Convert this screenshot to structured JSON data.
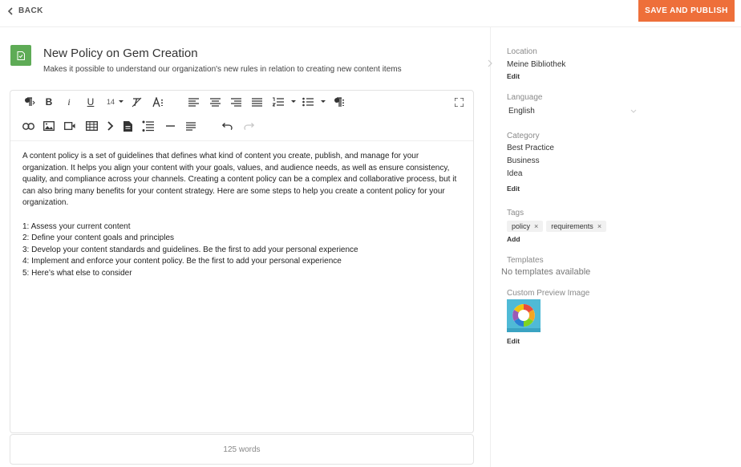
{
  "header": {
    "back_label": "BACK",
    "save_label": "SAVE AND PUBLISH",
    "accent": "#ee6f3a"
  },
  "document": {
    "title": "New Policy on Gem Creation",
    "subtitle": "Makes it possible to understand our organization's new rules in relation to creating new content items",
    "icon": "document-icon",
    "icon_color": "#5eab56"
  },
  "toolbar": {
    "font_size": "14",
    "buttons_row1": [
      "paragraph-format-icon",
      "bold-icon",
      "italic-icon",
      "underline-icon",
      "font-size-select",
      "clear-format-icon",
      "text-size-icon",
      "align-left-icon",
      "align-center-icon",
      "align-right-icon",
      "align-justify-icon",
      "ordered-list-icon",
      "unordered-list-icon",
      "paragraph-style-icon",
      "fullscreen-icon"
    ],
    "buttons_row2": [
      "link-icon",
      "image-icon",
      "video-icon",
      "table-icon",
      "code-icon",
      "file-icon",
      "checklist-icon",
      "horizontal-rule-icon",
      "text-align-icon",
      "undo-icon",
      "redo-icon"
    ]
  },
  "content": {
    "paragraph": "A content policy is a set of guidelines that defines what kind of content you create, publish, and manage for your organization. It helps you align your content with your goals, values, and audience needs, as well as ensure consistency, quality, and compliance across your channels. Creating a content policy can be a complex and collaborative process, but it can also bring many benefits for your content strategy. Here are some steps to help you create a content policy for your organization.",
    "steps": [
      "1: Assess your current content",
      "2: Define your content goals and principles",
      "3: Develop your content standards and guidelines. Be the first to add your personal experience",
      "4: Implement and enforce your content policy. Be the first to add your personal experience",
      "5: Here’s what else to consider"
    ],
    "word_count": "125 words"
  },
  "sidebar": {
    "location": {
      "label": "Location",
      "value": "Meine Bibliothek",
      "edit": "Edit"
    },
    "language": {
      "label": "Language",
      "value": "English"
    },
    "category": {
      "label": "Category",
      "values": [
        "Best Practice",
        "Business",
        "Idea"
      ],
      "edit": "Edit"
    },
    "tags": {
      "label": "Tags",
      "items": [
        "policy",
        "requirements"
      ],
      "remove": "×",
      "add": "Add"
    },
    "templates": {
      "label": "Templates",
      "value": "No templates available"
    },
    "preview": {
      "label": "Custom Preview Image",
      "edit": "Edit"
    }
  }
}
